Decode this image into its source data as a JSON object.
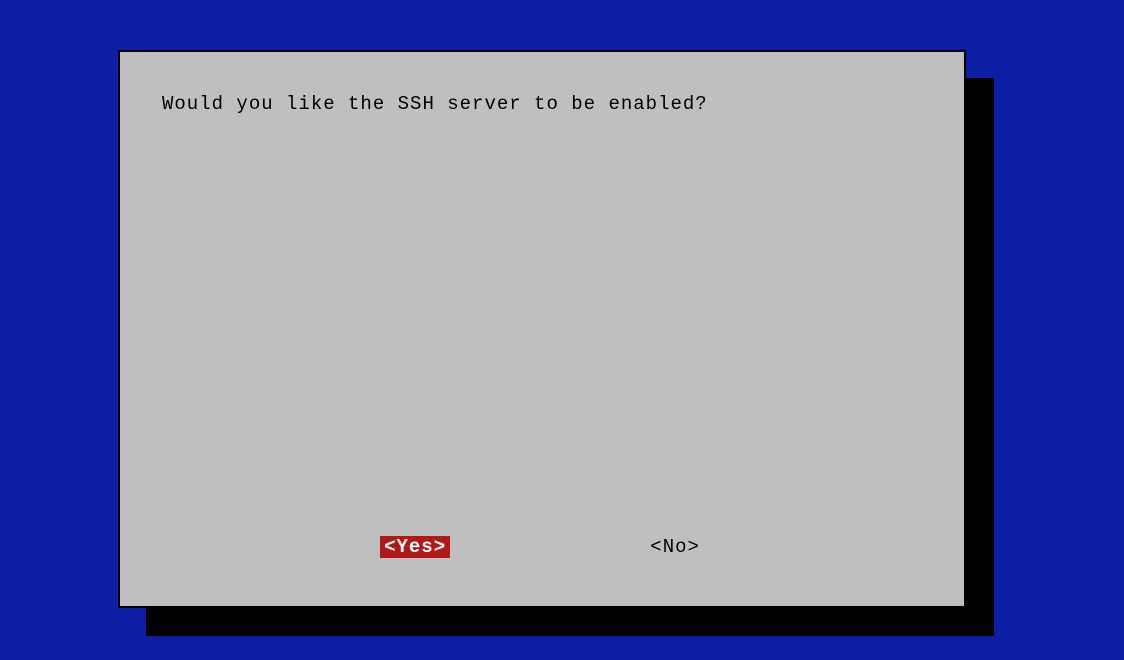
{
  "dialog": {
    "prompt": "Would you like the SSH server to be enabled?",
    "yes_label": "<Yes>",
    "no_label": "<No>"
  },
  "colors": {
    "background": "#0c1fa4",
    "panel": "#bfbfbf",
    "selected_bg": "#b11919",
    "selected_fg": "#ffffff"
  }
}
